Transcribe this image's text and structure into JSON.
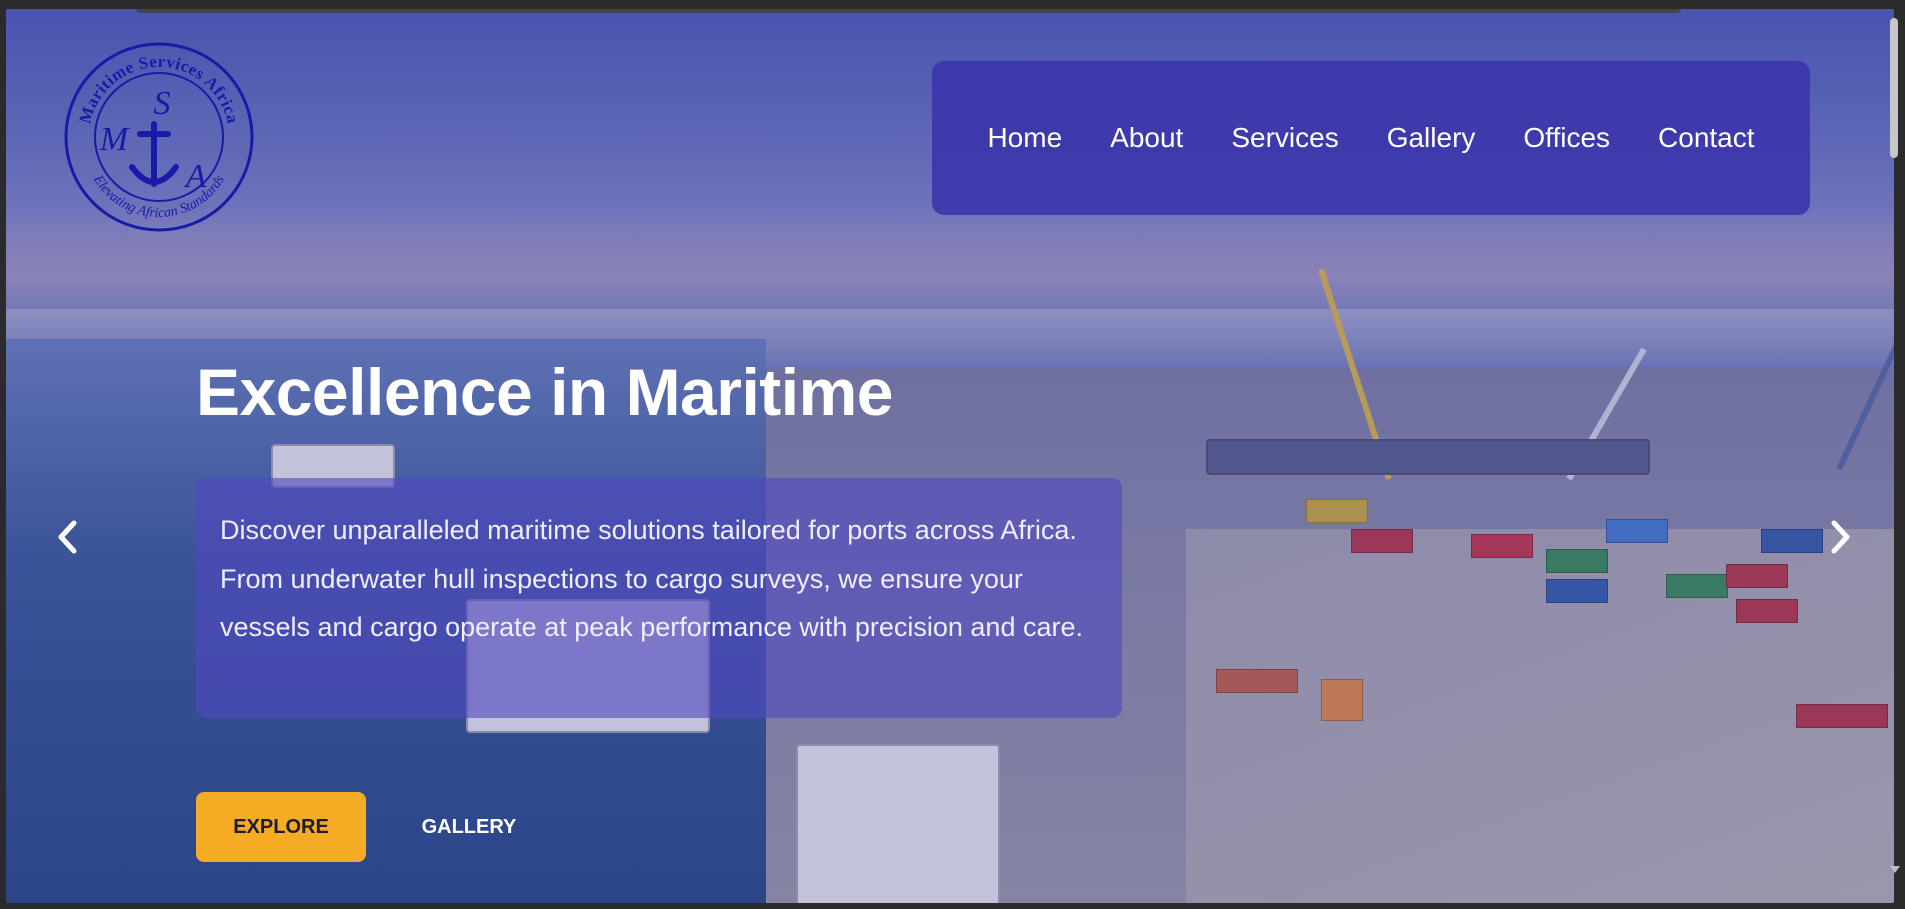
{
  "logo": {
    "top_text": "Maritime Services Africa",
    "bottom_text": "Elevating African Standards",
    "letter_m": "M",
    "letter_s": "S",
    "letter_a": "A",
    "icon": "anchor-icon",
    "color": "#1a1aa8"
  },
  "nav": {
    "items": [
      {
        "label": "Home"
      },
      {
        "label": "About"
      },
      {
        "label": "Services"
      },
      {
        "label": "Gallery"
      },
      {
        "label": "Offices"
      },
      {
        "label": "Contact"
      }
    ]
  },
  "hero": {
    "title": "Excellence in Maritime",
    "description": "Discover unparalleled maritime solutions tailored for ports across Africa. From underwater hull inspections to cargo surveys, we ensure your vessels and cargo operate at peak performance with precision and care.",
    "explore_label": "EXPLORE",
    "gallery_label": "GALLERY",
    "prev_icon": "chevron-left-icon",
    "next_icon": "chevron-right-icon"
  },
  "colors": {
    "accent": "#f6ab24",
    "nav_bg": "#3a32aa",
    "text": "#ffffff"
  }
}
